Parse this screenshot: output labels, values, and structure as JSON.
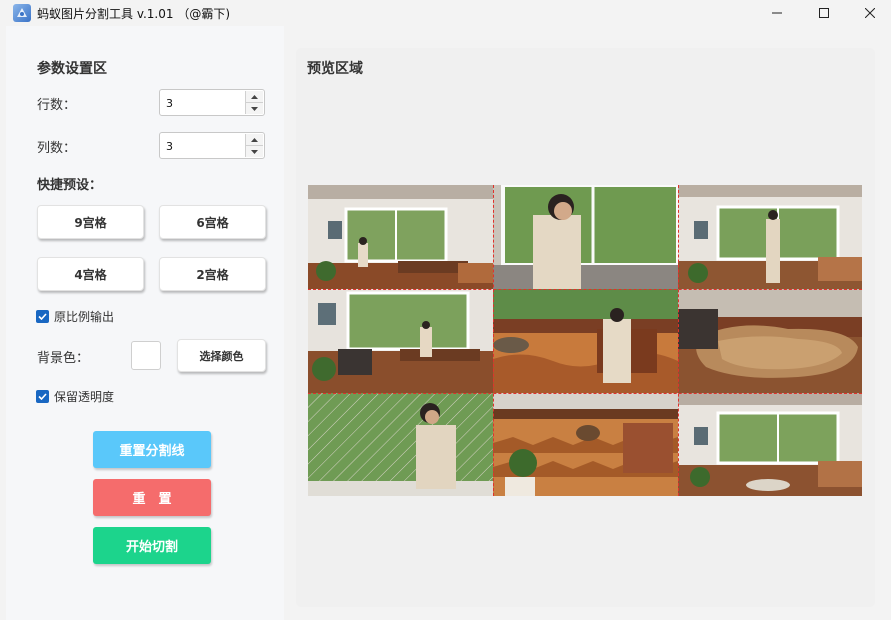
{
  "window": {
    "title": "蚂蚁图片分割工具 v.1.01  （@霸下)",
    "icon": "app-logo-icon",
    "controls": [
      "minimize-icon",
      "maximize-icon",
      "close-icon"
    ]
  },
  "settings": {
    "section_title": "参数设置区",
    "rows_label": "行数：",
    "rows_value": "3",
    "cols_label": "列数：",
    "cols_value": "3"
  },
  "presets": {
    "title": "快捷预设：",
    "buttons": [
      "9宫格",
      "6宫格",
      "4宫格",
      "2宫格"
    ]
  },
  "options": {
    "keep_ratio_label": "原比例输出",
    "keep_ratio_checked": true,
    "bg_color_label": "背景色：",
    "bg_color_value": "#ffffff",
    "choose_color_label": "选择颜色",
    "keep_alpha_label": "保留透明度",
    "keep_alpha_checked": true
  },
  "actions": {
    "reset_lines_label": "重置分割线",
    "reset_lines_color": "#5ac8fa",
    "reset_label": "重　置",
    "reset_color": "#f56c6c",
    "start_label": "开始切割",
    "start_color": "#1cd48c"
  },
  "preview": {
    "title": "预览区域",
    "grid_rows": 3,
    "grid_cols": 3,
    "split_line_color": "#e0322c"
  }
}
